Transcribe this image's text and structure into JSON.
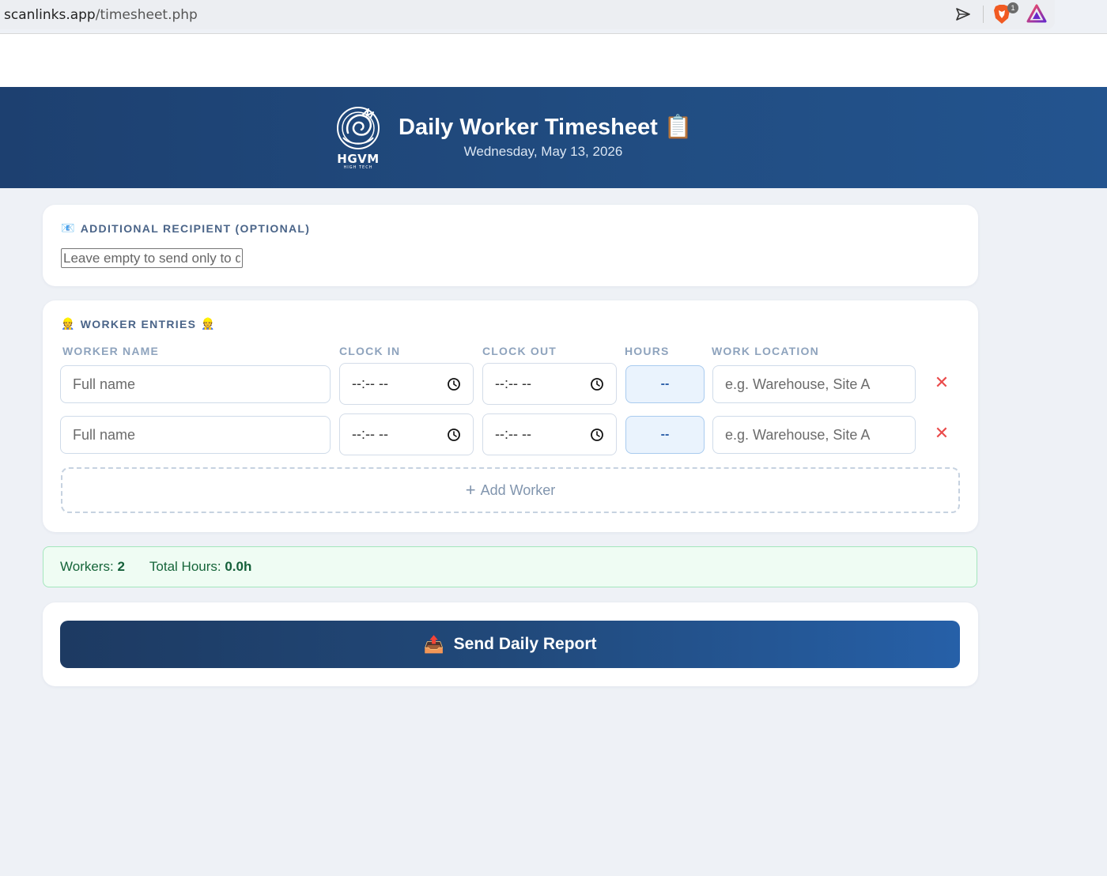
{
  "browser": {
    "url_host": "scanlinks.app",
    "url_path": "/timesheet.php",
    "extension_badge": "1"
  },
  "header": {
    "logo_text": "HGVM",
    "logo_subtext": "HIGH TECH",
    "title": "Daily Worker Timesheet 📋",
    "date": "Wednesday, May 13, 2026"
  },
  "recipient": {
    "icon": "📧",
    "label": "ADDITIONAL RECIPIENT (OPTIONAL)",
    "placeholder": "Leave empty to send only to default",
    "value": ""
  },
  "workers": {
    "icon": "👷",
    "label": "WORKER ENTRIES",
    "columns": {
      "name": "WORKER NAME",
      "clock_in": "CLOCK IN",
      "clock_out": "CLOCK OUT",
      "hours": "HOURS",
      "location": "WORK LOCATION"
    },
    "rows": [
      {
        "name_placeholder": "Full name",
        "clock_in": "--:-- --",
        "clock_out": "--:-- --",
        "hours": "--",
        "location_placeholder": "e.g. Warehouse, Site A"
      },
      {
        "name_placeholder": "Full name",
        "clock_in": "--:-- --",
        "clock_out": "--:-- --",
        "hours": "--",
        "location_placeholder": "e.g. Warehouse, Site A"
      }
    ],
    "remove_symbol": "✕",
    "add_label": "Add Worker"
  },
  "summary": {
    "workers_label": "Workers:",
    "workers_value": "2",
    "hours_label": "Total Hours:",
    "hours_value": "0.0h"
  },
  "send": {
    "icon": "📤",
    "label": "Send Daily Report"
  },
  "colors": {
    "header_bg": "#1d4070",
    "accent": "#2660a8",
    "remove": "#ea4b4b",
    "summary_bg": "#effcf3"
  }
}
